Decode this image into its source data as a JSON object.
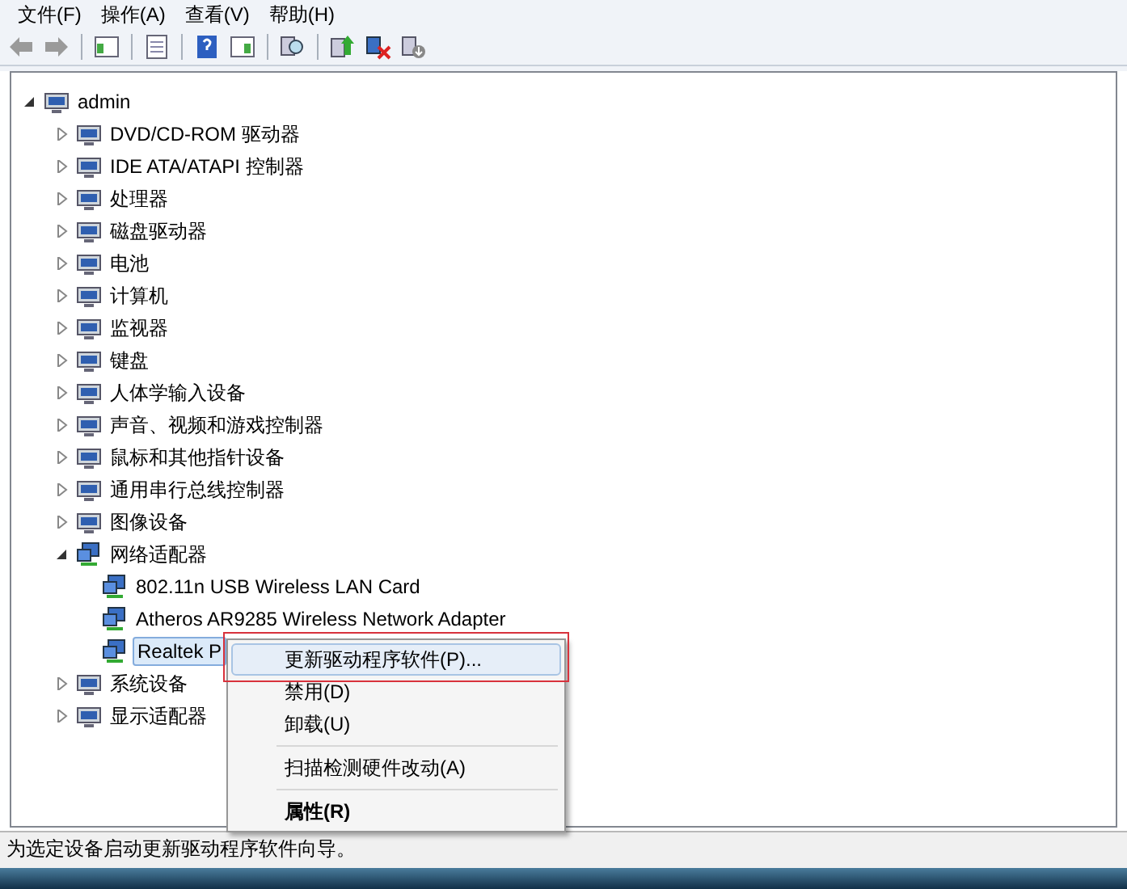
{
  "menu_bar": [
    {
      "label": "文件(F)"
    },
    {
      "label": "操作(A)"
    },
    {
      "label": "查看(V)"
    },
    {
      "label": "帮助(H)"
    }
  ],
  "tree": {
    "label": "admin",
    "expanded": true,
    "children": [
      {
        "label": "DVD/CD-ROM 驱动器",
        "expanded": false
      },
      {
        "label": "IDE ATA/ATAPI 控制器",
        "expanded": false
      },
      {
        "label": "处理器",
        "expanded": false
      },
      {
        "label": "磁盘驱动器",
        "expanded": false
      },
      {
        "label": "电池",
        "expanded": false
      },
      {
        "label": "计算机",
        "expanded": false
      },
      {
        "label": "监视器",
        "expanded": false
      },
      {
        "label": "键盘",
        "expanded": false
      },
      {
        "label": "人体学输入设备",
        "expanded": false
      },
      {
        "label": "声音、视频和游戏控制器",
        "expanded": false
      },
      {
        "label": "鼠标和其他指针设备",
        "expanded": false
      },
      {
        "label": "通用串行总线控制器",
        "expanded": false
      },
      {
        "label": "图像设备",
        "expanded": false
      },
      {
        "label": "网络适配器",
        "expanded": true,
        "children": [
          {
            "label": "802.11n USB Wireless LAN Card",
            "selected": false
          },
          {
            "label": "Atheros AR9285 Wireless Network Adapter",
            "selected": false
          },
          {
            "label": "Realtek P",
            "selected": true
          }
        ]
      },
      {
        "label": "系统设备",
        "expanded": false
      },
      {
        "label": "显示适配器",
        "expanded": false
      }
    ]
  },
  "context_menu": [
    {
      "kind": "item",
      "label": "更新驱动程序软件(P)...",
      "selected": true,
      "default": false
    },
    {
      "kind": "item",
      "label": "禁用(D)",
      "selected": false,
      "default": false
    },
    {
      "kind": "item",
      "label": "卸载(U)",
      "selected": false,
      "default": false
    },
    {
      "kind": "separator"
    },
    {
      "kind": "item",
      "label": "扫描检测硬件改动(A)",
      "selected": false,
      "default": false
    },
    {
      "kind": "separator"
    },
    {
      "kind": "item",
      "label": "属性(R)",
      "selected": false,
      "default": true
    }
  ],
  "status_bar": "为选定设备启动更新驱动程序软件向导。"
}
